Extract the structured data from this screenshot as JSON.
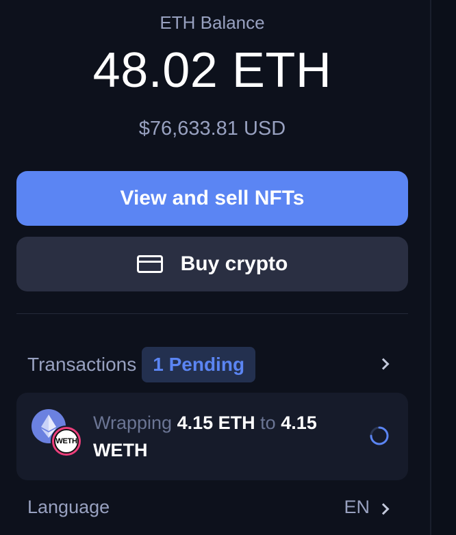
{
  "balance": {
    "label": "ETH Balance",
    "amount": "48.02 ETH",
    "fiat": "$76,633.81 USD"
  },
  "actions": {
    "primary_label": "View and sell NFTs",
    "secondary_label": "Buy crypto",
    "secondary_icon": "credit-card-icon"
  },
  "transactions": {
    "label": "Transactions",
    "pending_badge": "1 Pending",
    "items": [
      {
        "verb": "Wrapping",
        "from_amount": "4.15 ETH",
        "connector": "to",
        "to_amount": "4.15",
        "to_token": "WETH",
        "from_icon": "eth-icon",
        "to_icon": "weth-icon",
        "weth_logo_text": "WETH",
        "status_icon": "loading-spinner-icon"
      }
    ]
  },
  "settings": {
    "language_label": "Language",
    "language_value": "EN"
  },
  "colors": {
    "background": "#0d111c",
    "accent": "#5b85f3",
    "secondary_button": "#2a2f42",
    "muted_text": "#98a1c0"
  }
}
